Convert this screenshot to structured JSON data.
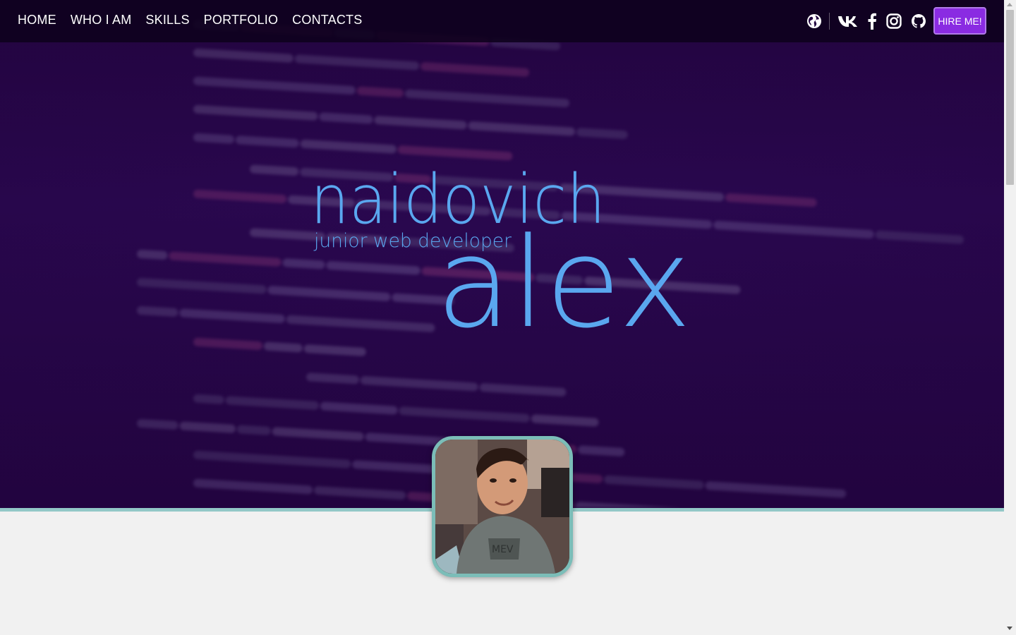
{
  "nav": {
    "items": [
      {
        "label": "HOME"
      },
      {
        "label": "WHO I AM"
      },
      {
        "label": "SKILLS"
      },
      {
        "label": "PORTFOLIO"
      },
      {
        "label": "CONTACTS"
      }
    ]
  },
  "social": {
    "icons": [
      "globe-icon",
      "vk-icon",
      "facebook-icon",
      "instagram-icon",
      "github-icon"
    ]
  },
  "hire_button": {
    "label": "HIRE ME!"
  },
  "hero": {
    "last_name": "naidovich",
    "tagline": "junior web developer",
    "first_name": "alex"
  },
  "colors": {
    "accent": "#8a2be2",
    "logo": "#5aa7ef",
    "hero_bg": "#260548",
    "avatar_border": "#7bbdb8",
    "page_bg": "#f1f1f1"
  }
}
